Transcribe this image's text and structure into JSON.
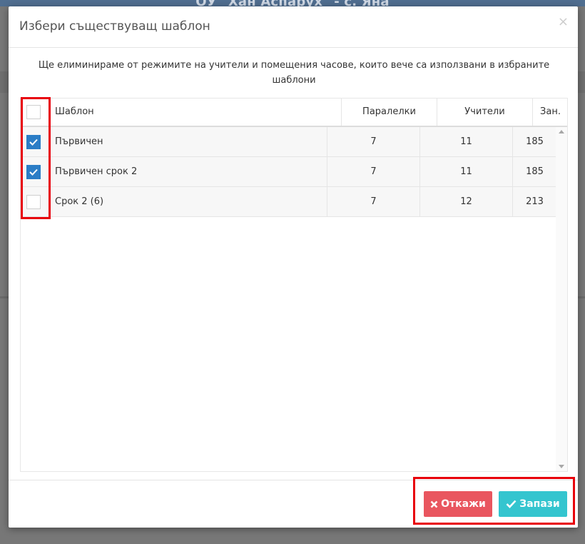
{
  "background": {
    "title": "ОУ \"Хан Аспарух\" - с. Яна"
  },
  "modal": {
    "title": "Избери съществуващ шаблон",
    "close_label": "×",
    "info": "Ще елиминираме от режимите на учители и помещения часове, които вече са използвани в избраните шаблони"
  },
  "table": {
    "columns": [
      "Шаблон",
      "Паралелки",
      "Учители",
      "Зан."
    ],
    "select_all_checked": false,
    "rows": [
      {
        "checked": true,
        "name": "Първичен",
        "classes": "7",
        "teachers": "11",
        "lessons": "185"
      },
      {
        "checked": true,
        "name": "Първичен срок 2",
        "classes": "7",
        "teachers": "11",
        "lessons": "185"
      },
      {
        "checked": false,
        "name": "Срок 2 (6)",
        "classes": "7",
        "teachers": "12",
        "lessons": "213"
      }
    ]
  },
  "buttons": {
    "cancel": {
      "label": "Откажи",
      "icon": "times-icon",
      "color": "#e9565f"
    },
    "save": {
      "label": "Запази",
      "icon": "check-icon",
      "color": "#34c5cf"
    }
  },
  "colors": {
    "checkbox_checked": "#2b7dc6",
    "highlight": "#e8000b",
    "backdrop": "#777777"
  }
}
